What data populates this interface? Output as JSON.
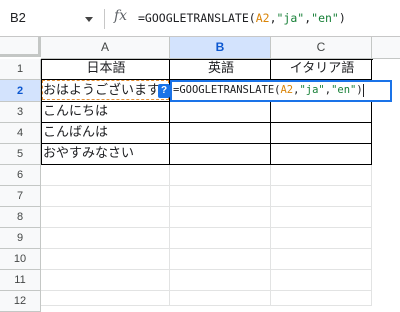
{
  "name_box": "B2",
  "formula_bar": {
    "fx_label": "fx",
    "fn": "=GOOGLETRANSLATE(",
    "ref": "A2",
    "sep1": ",",
    "src": "\"ja\"",
    "sep2": ",",
    "dst": "\"en\"",
    "close": ")"
  },
  "columns": [
    "A",
    "B",
    "C"
  ],
  "rows": [
    "1",
    "2",
    "3",
    "4",
    "5",
    "6",
    "7",
    "8",
    "9",
    "10",
    "11",
    "12"
  ],
  "cells": {
    "A1": "日本語",
    "B1": "英語",
    "C1": "イタリア語",
    "A2": "おはようございます",
    "A3": "こんにちは",
    "A4": "こんばんは",
    "A5": "おやすみなさい"
  },
  "editor_help": "?",
  "colors": {
    "selection": "#1a73e8",
    "header_selected": "#d3e3fd",
    "ref_highlight": "#e69138",
    "string_token": "#188038"
  }
}
